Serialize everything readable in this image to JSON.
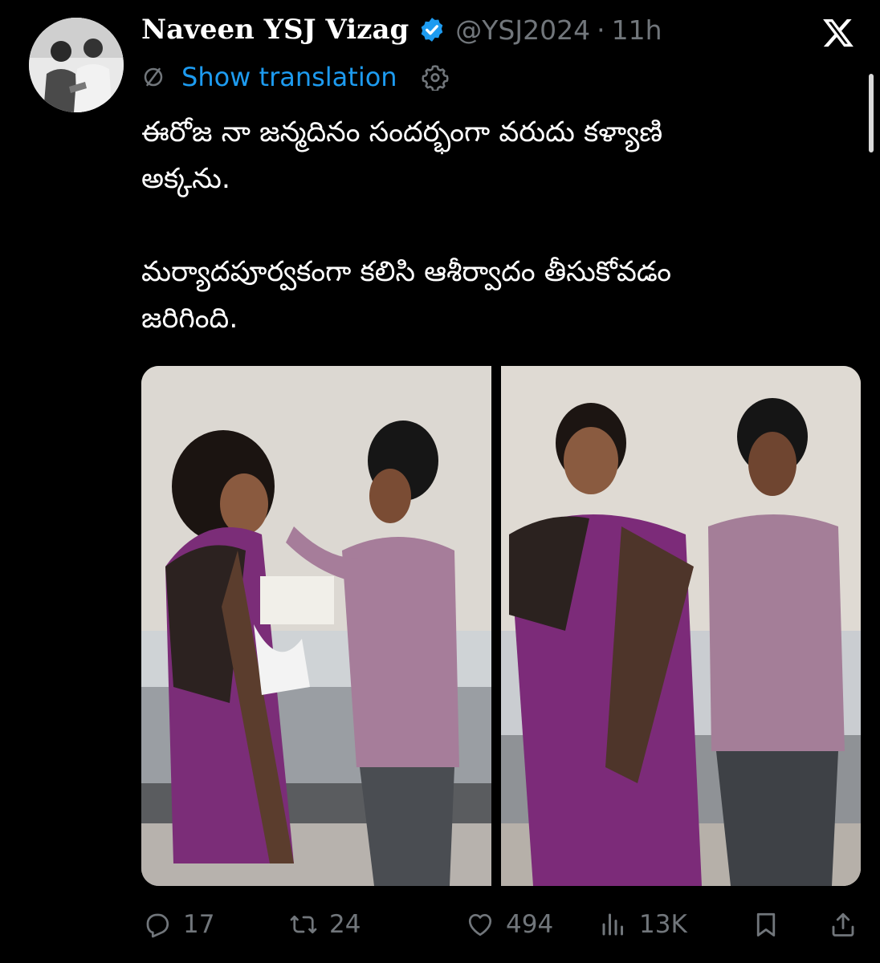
{
  "author": {
    "display_name": "Naveen YSJ Vizag",
    "handle": "@YSJ2024",
    "separator": "·",
    "time": "11h",
    "verified": true,
    "avatar_icon": "profile-avatar"
  },
  "translation": {
    "label": "Show translation",
    "icon": "translate-icon",
    "settings_icon": "gear-icon"
  },
  "tweet": {
    "lines": [
      "ఈరోజ నా జన్మదినం సందర్భంగా వరుదు కళ్యాణి",
      "అక్కను.",
      "",
      "మర్యాదపూర్వకంగా కలిసి ఆశీర్వాదం తీసుకోవడం",
      "జరిగింది."
    ]
  },
  "media": {
    "count": 2,
    "photos": [
      "photo-cake-feeding",
      "photo-posed-standing"
    ]
  },
  "actions": {
    "reply": {
      "icon": "reply-icon",
      "count": "17"
    },
    "repost": {
      "icon": "repost-icon",
      "count": "24"
    },
    "like": {
      "icon": "heart-icon",
      "count": "494"
    },
    "views": {
      "icon": "views-icon",
      "count": "13K"
    },
    "bookmark": {
      "icon": "bookmark-icon"
    },
    "share": {
      "icon": "share-icon"
    }
  },
  "colors": {
    "background": "#000000",
    "text_primary": "#ffffff",
    "text_secondary": "#71767b",
    "link": "#1d9bf0",
    "verified_badge": "#1d9bf0"
  }
}
